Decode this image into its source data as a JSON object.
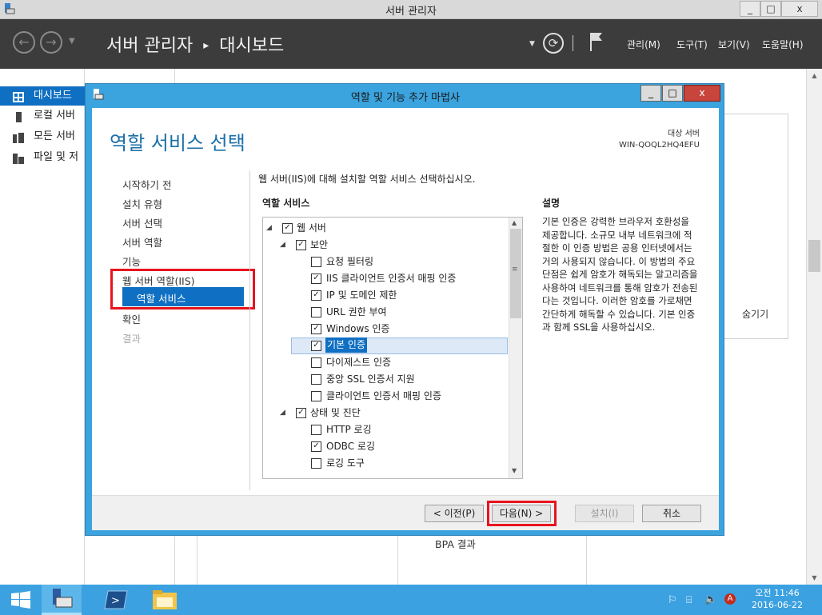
{
  "window": {
    "title": "서버 관리자",
    "minimize": "_",
    "maximize": "□",
    "close": "x"
  },
  "header": {
    "breadcrumb_root": "서버 관리자",
    "breadcrumb_sep": "▸",
    "breadcrumb_current": "대시보드",
    "menus": [
      "관리(M)",
      "도구(T)",
      "보기(V)",
      "도움말(H)"
    ]
  },
  "left_nav": {
    "items": [
      {
        "label": "대시보드",
        "icon": "dashboard-icon"
      },
      {
        "label": "로컬 서버",
        "icon": "server-icon"
      },
      {
        "label": "모든 서버",
        "icon": "servers-icon"
      },
      {
        "label": "파일 및 저",
        "icon": "files-icon"
      }
    ]
  },
  "background": {
    "hide_label": "숨기기",
    "bpa_label": "BPA 결과"
  },
  "dialog": {
    "title": "역할 및 기능 추가 마법사",
    "heading": "역할 서비스 선택",
    "target_label": "대상 서버",
    "target_server": "WIN-QOQL2HQ4EFU",
    "instruction": "웹 서버(IIS)에 대해 설치할 역할 서비스 선택하십시오.",
    "list_header": "역할 서비스",
    "desc_header": "설명",
    "description": "기본 인증은 강력한 브라우저 호환성을 제공합니다. 소규모 내부 네트워크에 적절한 이 인증 방법은 공용 인터넷에서는 거의 사용되지 않습니다. 이 방법의 주요 단점은 쉽게 암호가 해독되는 알고리즘을 사용하여 네트워크를 통해 암호가 전송된다는 것입니다. 이러한 암호를 가로채면 간단하게 해독할 수 있습니다. 기본 인증과 함께 SSL을 사용하십시오.",
    "steps": [
      "시작하기 전",
      "설치 유형",
      "서버 선택",
      "서버 역할",
      "기능",
      "웹 서버 역할(IIS)",
      "역할 서비스",
      "확인",
      "결과"
    ],
    "tree": [
      {
        "label": "웹 서버",
        "checked": true,
        "level": 0,
        "expander": "◢"
      },
      {
        "label": "보안",
        "checked": true,
        "level": 1,
        "expander": "◢"
      },
      {
        "label": "요청 필터링",
        "checked": false,
        "level": 2
      },
      {
        "label": "IIS 클라이언트 인증서 매핑 인증",
        "checked": true,
        "level": 2
      },
      {
        "label": "IP 및 도메인 제한",
        "checked": true,
        "level": 2
      },
      {
        "label": "URL 권한 부여",
        "checked": false,
        "level": 2
      },
      {
        "label": "Windows 인증",
        "checked": true,
        "level": 2
      },
      {
        "label": "기본 인증",
        "checked": true,
        "level": 2,
        "selected": true
      },
      {
        "label": "다이제스트 인증",
        "checked": false,
        "level": 2
      },
      {
        "label": "중앙 SSL 인증서 지원",
        "checked": false,
        "level": 2
      },
      {
        "label": "클라이언트 인증서 매핑 인증",
        "checked": false,
        "level": 2
      },
      {
        "label": "상태 및 진단",
        "checked": true,
        "level": 1,
        "expander": "◢"
      },
      {
        "label": "HTTP 로깅",
        "checked": false,
        "level": 2
      },
      {
        "label": "ODBC 로깅",
        "checked": true,
        "level": 2
      },
      {
        "label": "로깅 도구",
        "checked": false,
        "level": 2
      }
    ],
    "buttons": {
      "prev": "< 이전(P)",
      "next": "다음(N) >",
      "install": "설치(I)",
      "cancel": "취소"
    }
  },
  "taskbar": {
    "time": "오전 11:46",
    "date": "2016-06-22"
  },
  "colors": {
    "accent": "#0f6fc2",
    "highlight": "#e8141d",
    "dialog_frame": "#3ba3de"
  }
}
